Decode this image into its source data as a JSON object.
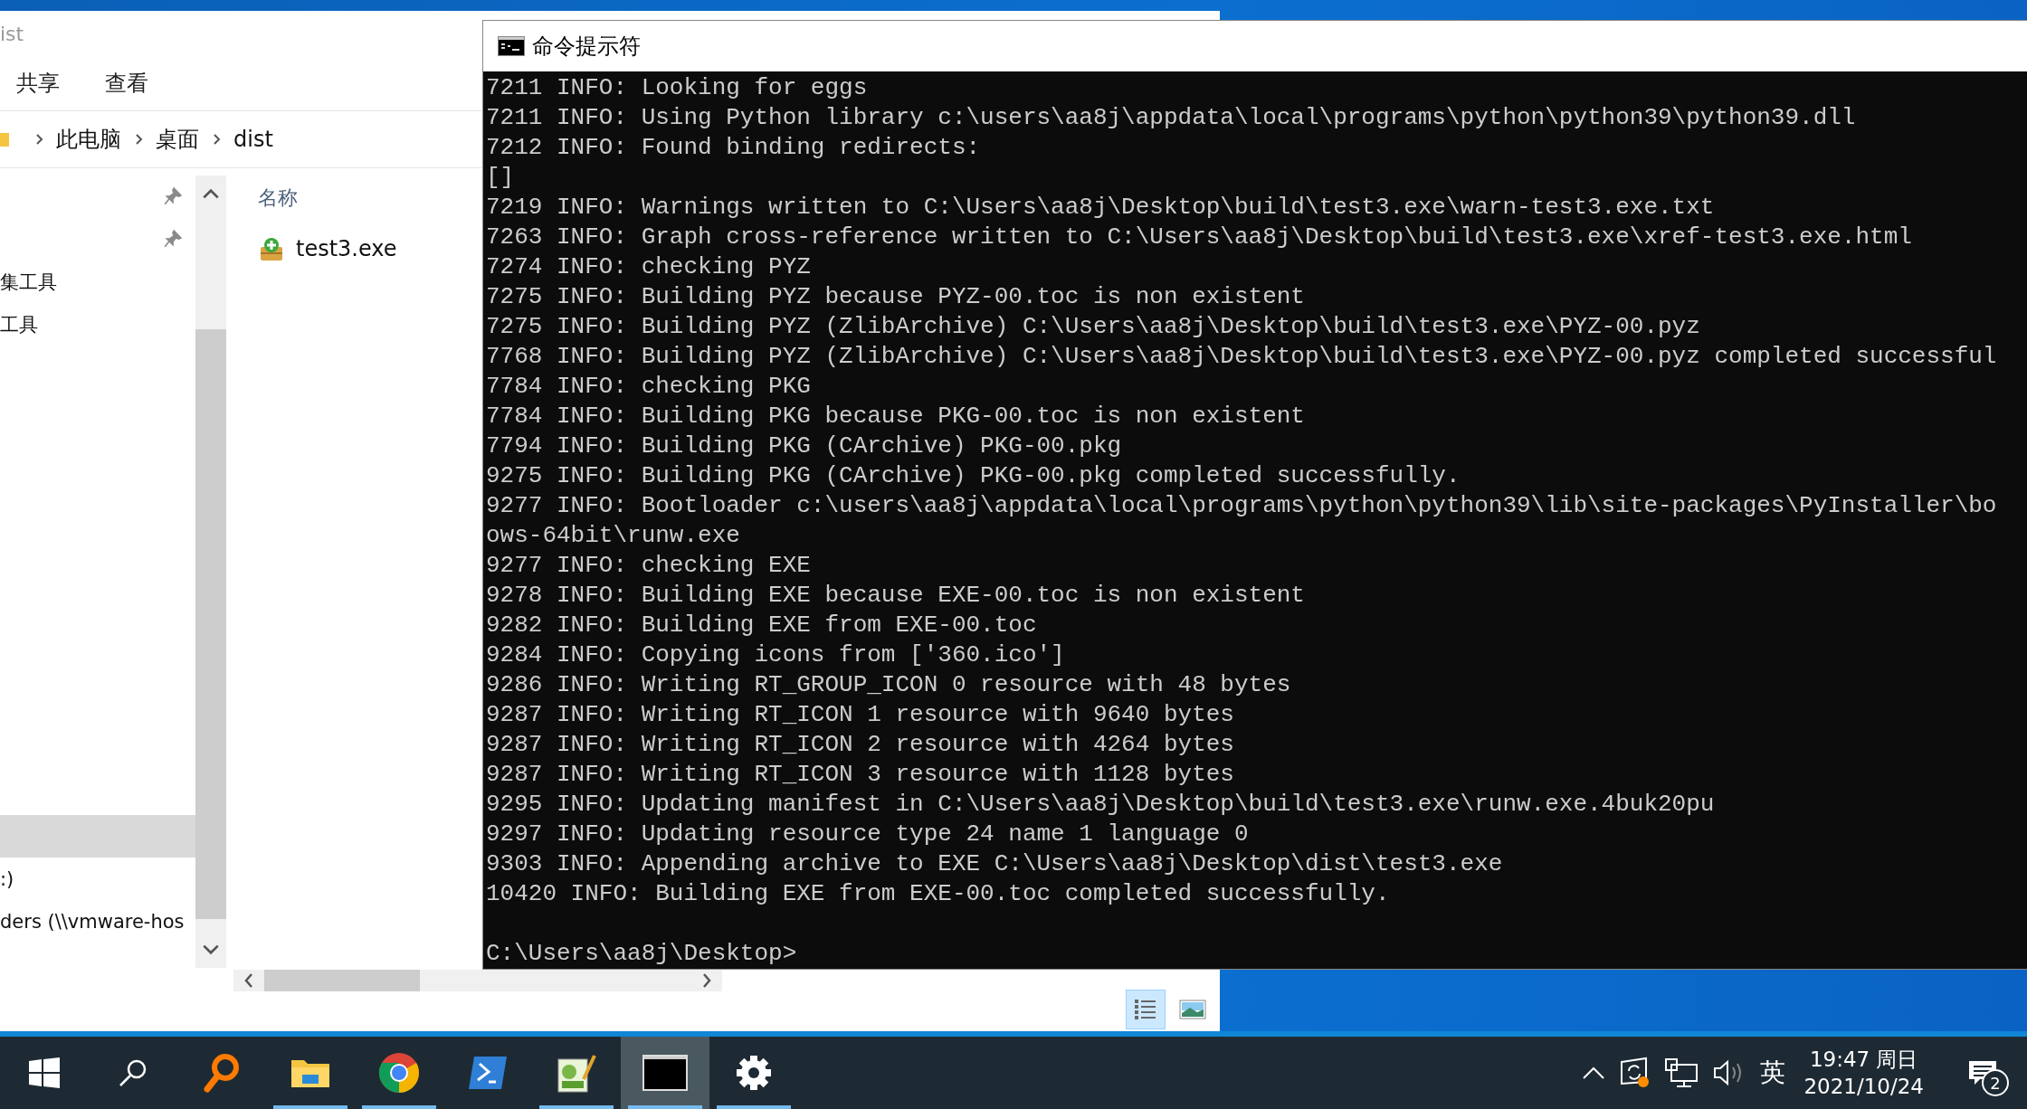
{
  "explorer": {
    "title": "ist",
    "ribbon_tabs": [
      {
        "label": "共享"
      },
      {
        "label": "查看"
      }
    ],
    "breadcrumb": [
      "此电脑",
      "桌面",
      "dist"
    ],
    "nav_sections": [
      {
        "items": [
          {
            "pinned": true,
            "selected": false
          },
          {
            "pinned": true,
            "selected": false
          },
          {
            "label": "集工具",
            "pinned": false,
            "selected": false
          },
          {
            "label": "工具",
            "pinned": false,
            "selected": false
          }
        ]
      },
      {
        "items": [
          {
            "pinned": false,
            "selected": true
          },
          {
            "label": ":)",
            "pinned": false,
            "selected": false
          },
          {
            "label": "ders (\\\\vmware-hos",
            "pinned": false,
            "selected": false
          }
        ]
      }
    ],
    "column_header": "名称",
    "files": [
      {
        "name": "test3.exe"
      }
    ],
    "view_buttons": [
      {
        "kind": "details",
        "selected": true
      },
      {
        "kind": "tiles",
        "selected": false
      }
    ]
  },
  "console": {
    "title": "命令提示符",
    "lines": [
      "7211 INFO: Looking for eggs",
      "7211 INFO: Using Python library c:\\users\\aa8j\\appdata\\local\\programs\\python\\python39\\python39.dll",
      "7212 INFO: Found binding redirects:",
      "[]",
      "7219 INFO: Warnings written to C:\\Users\\aa8j\\Desktop\\build\\test3.exe\\warn-test3.exe.txt",
      "7263 INFO: Graph cross-reference written to C:\\Users\\aa8j\\Desktop\\build\\test3.exe\\xref-test3.exe.html",
      "7274 INFO: checking PYZ",
      "7275 INFO: Building PYZ because PYZ-00.toc is non existent",
      "7275 INFO: Building PYZ (ZlibArchive) C:\\Users\\aa8j\\Desktop\\build\\test3.exe\\PYZ-00.pyz",
      "7768 INFO: Building PYZ (ZlibArchive) C:\\Users\\aa8j\\Desktop\\build\\test3.exe\\PYZ-00.pyz completed successful",
      "7784 INFO: checking PKG",
      "7784 INFO: Building PKG because PKG-00.toc is non existent",
      "7794 INFO: Building PKG (CArchive) PKG-00.pkg",
      "9275 INFO: Building PKG (CArchive) PKG-00.pkg completed successfully.",
      "9277 INFO: Bootloader c:\\users\\aa8j\\appdata\\local\\programs\\python\\python39\\lib\\site-packages\\PyInstaller\\bo",
      "ows-64bit\\runw.exe",
      "9277 INFO: checking EXE",
      "9278 INFO: Building EXE because EXE-00.toc is non existent",
      "9282 INFO: Building EXE from EXE-00.toc",
      "9284 INFO: Copying icons from ['360.ico']",
      "9286 INFO: Writing RT_GROUP_ICON 0 resource with 48 bytes",
      "9287 INFO: Writing RT_ICON 1 resource with 9640 bytes",
      "9287 INFO: Writing RT_ICON 2 resource with 4264 bytes",
      "9287 INFO: Writing RT_ICON 3 resource with 1128 bytes",
      "9295 INFO: Updating manifest in C:\\Users\\aa8j\\Desktop\\build\\test3.exe\\runw.exe.4buk20pu",
      "9297 INFO: Updating resource type 24 name 1 language 0",
      "9303 INFO: Appending archive to EXE C:\\Users\\aa8j\\Desktop\\dist\\test3.exe",
      "10420 INFO: Building EXE from EXE-00.toc completed successfully."
    ],
    "prompt": "C:\\Users\\aa8j\\Desktop>"
  },
  "taskbar": {
    "apps": [
      {
        "kind": "start",
        "running": false,
        "active": false
      },
      {
        "kind": "search",
        "running": false,
        "active": false
      },
      {
        "kind": "magnifier",
        "running": false,
        "active": false
      },
      {
        "kind": "explorer",
        "running": true,
        "active": false
      },
      {
        "kind": "chrome",
        "running": true,
        "active": false
      },
      {
        "kind": "powershell",
        "running": false,
        "active": false
      },
      {
        "kind": "notepad",
        "running": true,
        "active": false
      },
      {
        "kind": "console",
        "running": true,
        "active": true
      },
      {
        "kind": "settings",
        "running": true,
        "active": false
      }
    ],
    "ime": "英",
    "time": "19:47 周日",
    "date": "2021/10/24",
    "notifications": "2"
  }
}
